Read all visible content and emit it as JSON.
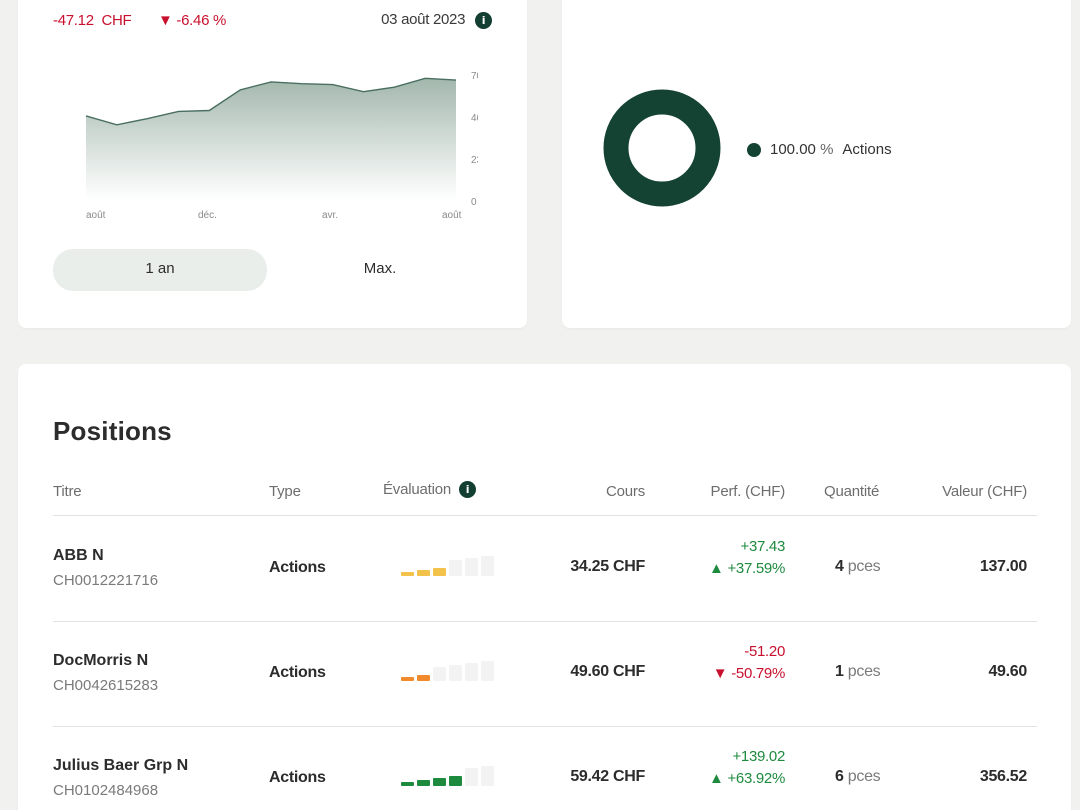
{
  "performance": {
    "change_amount": "-47.12",
    "currency": "CHF",
    "change_percent": "-6.46 %",
    "date": "03 août 2023",
    "y_ticks": [
      "704",
      "469",
      "235",
      "0"
    ],
    "x_ticks": [
      "août",
      "déc.",
      "avr.",
      "août"
    ],
    "ranges": [
      "1 an",
      "Max."
    ],
    "active_range": "1 an",
    "chart_color": "#4a6f60"
  },
  "chart_data": {
    "type": "area",
    "x": [
      "août",
      "",
      "",
      "",
      "déc.",
      "",
      "",
      "",
      "avr.",
      "",
      "",
      "",
      "",
      "",
      "",
      "août"
    ],
    "series": [
      {
        "values": [
          470,
          420,
          455,
          495,
          500,
          615,
          660,
          650,
          645,
          605,
          630,
          680,
          670
        ]
      }
    ],
    "ylim": [
      0,
      704
    ]
  },
  "allocation": {
    "slices": [
      {
        "label": "Actions",
        "percent": "100.00",
        "color": "#144334"
      }
    ]
  },
  "positions": {
    "title": "Positions",
    "columns": [
      "Titre",
      "Type",
      "Évaluation",
      "Cours",
      "Perf. (CHF)",
      "Quantité",
      "Valeur (CHF)"
    ],
    "rows": [
      {
        "name": "ABB N",
        "isin": "CH0012221716",
        "type": "Actions",
        "rating": 3,
        "rating_color": "#f2c24a",
        "price": "34.25 CHF",
        "perf_abs": "+37.43",
        "perf_pct": "+37.59%",
        "direction": "up",
        "qty": "4",
        "qty_unit": "pces",
        "value": "137.00"
      },
      {
        "name": "DocMorris N",
        "isin": "CH0042615283",
        "type": "Actions",
        "rating": 2,
        "rating_color": "#f08a2c",
        "price": "49.60 CHF",
        "perf_abs": "-51.20",
        "perf_pct": "-50.79%",
        "direction": "down",
        "qty": "1",
        "qty_unit": "pces",
        "value": "49.60"
      },
      {
        "name": "Julius Baer Grp N",
        "isin": "CH0102484968",
        "type": "Actions",
        "rating": 4,
        "rating_color": "#1e8a3e",
        "price": "59.42 CHF",
        "perf_abs": "+139.02",
        "perf_pct": "+63.92%",
        "direction": "up",
        "qty": "6",
        "qty_unit": "pces",
        "value": "356.52"
      }
    ]
  }
}
